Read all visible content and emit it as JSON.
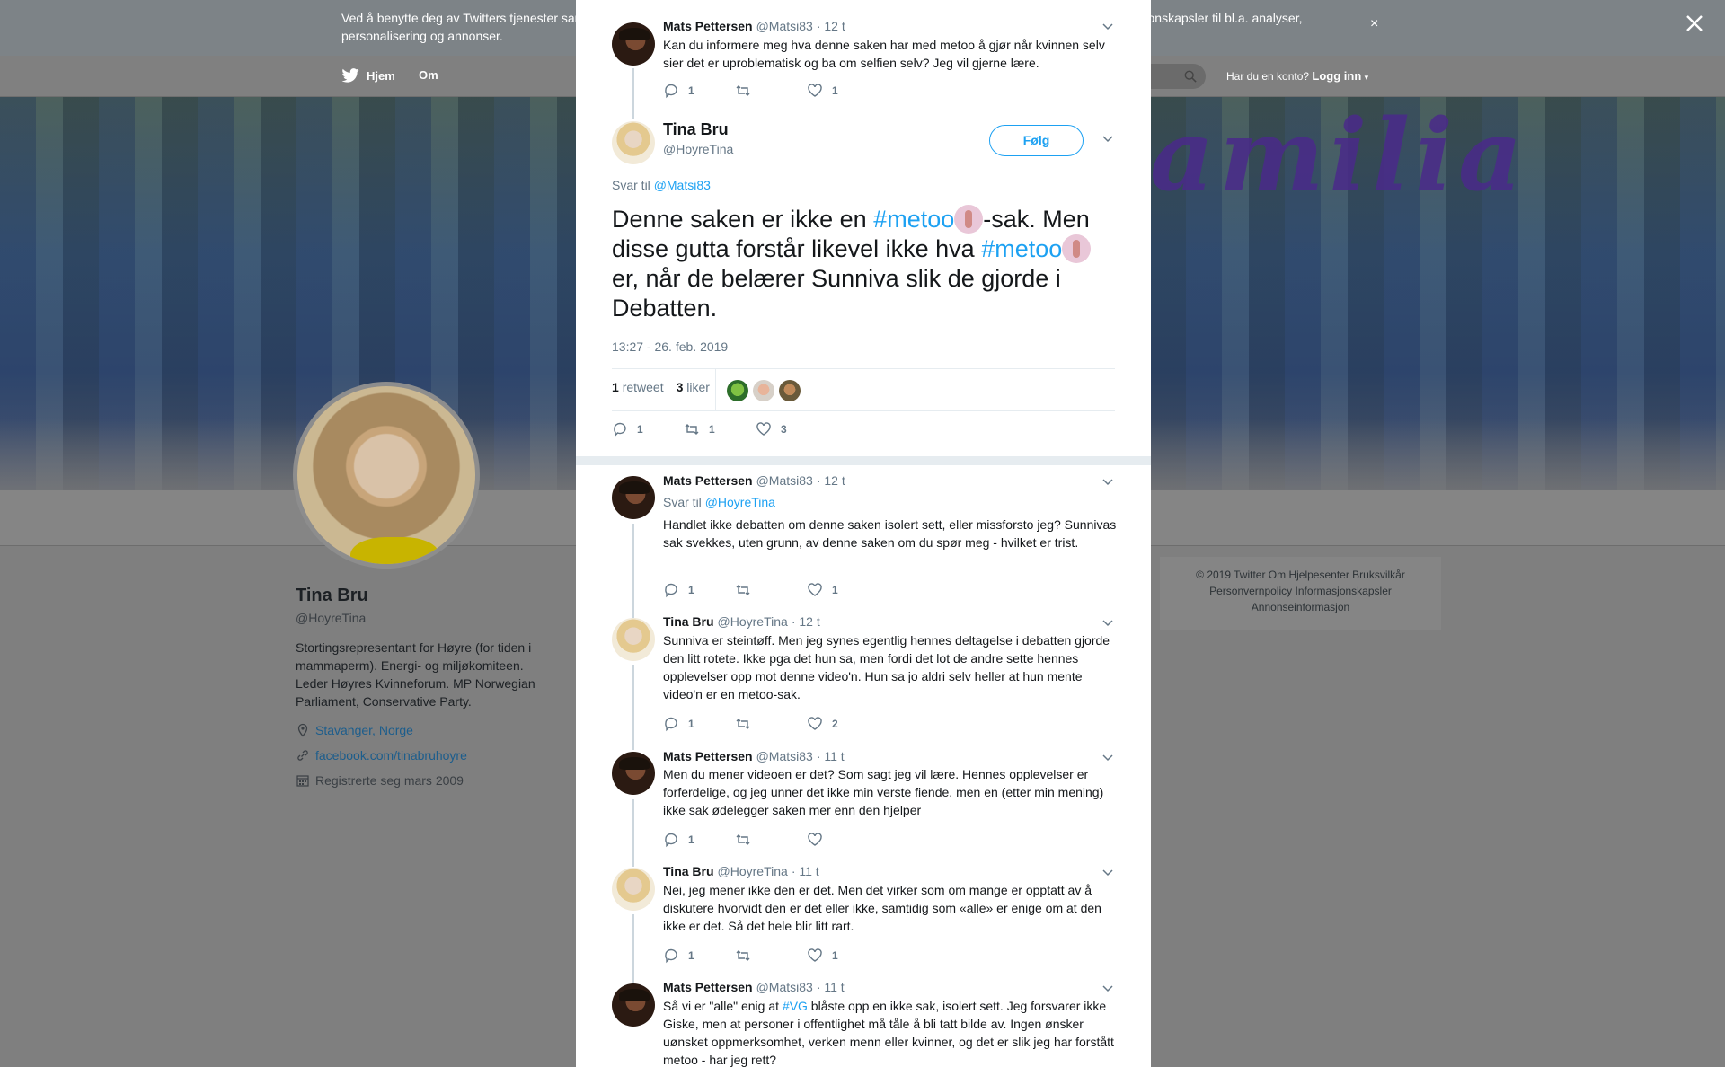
{
  "cookie_banner": {
    "text": "Ved å benytte deg av Twitters tjenester samtykker du i vår bruk av informasjonskapsler. Vi og våre partnere arbeider globalt og benytter informasjonskapsler til bl.a. analyser, personalisering og annonser.",
    "close": "×"
  },
  "nav": {
    "home": "Hjem",
    "about": "Om",
    "account_prompt": "Har du en konto?",
    "login": "Logg inn"
  },
  "banner_word": "amilia",
  "profile": {
    "name": "Tina Bru",
    "handle": "@HoyreTina",
    "bio": "Stortingsrepresentant for Høyre (for tiden i mammaperm). Energi- og miljøkomiteen. Leder Høyres Kvinneforum. MP Norwegian Parliament, Conservative Party.",
    "location": "Stavanger, Norge",
    "website": "facebook.com/tinabruhoyre",
    "joined": "Registrerte seg mars 2009"
  },
  "footer": {
    "line1": "© 2019 Twitter   Om   Hjelpesenter   Bruksvilkår",
    "line2": "Personvernpolicy   Informasjonskapsler",
    "line3": "Annonseinformasjon"
  },
  "modal": {
    "parent": {
      "name": "Mats Pettersen",
      "handle": "@Matsi83",
      "time": "· 12 t",
      "text": "Kan du informere meg hva denne saken har med metoo å gjør når kvinnen selv sier det er uproblematisk og ba om selfien selv? Jeg vil gjerne lære.",
      "replies": "1",
      "retweets": "",
      "likes": "1"
    },
    "main": {
      "name": "Tina Bru",
      "handle": "@HoyreTina",
      "follow": "Følg",
      "reply_label": "Svar til",
      "reply_handle": "@Matsi83",
      "text_1": "Denne saken er ikke en ",
      "hashtag_1": "#metoo",
      "text_2": "-sak. Men disse gutta forstår likevel ikke hva ",
      "hashtag_2": "#metoo",
      "text_3": "er, når de belærer Sunniva slik de gjorde i Debatten.",
      "timestamp": "13:27 - 26. feb. 2019",
      "retweet_count": "1",
      "retweet_label": "retweet",
      "like_count": "3",
      "like_label": "liker",
      "replies": "1",
      "retweets": "1",
      "likes": "3"
    },
    "replies": [
      {
        "name": "Mats Pettersen",
        "handle": "@Matsi83",
        "time": "· 12 t",
        "reply_label": "Svar til",
        "reply_handle": "@HoyreTina",
        "text": "Handlet ikke debatten om denne saken isolert sett, eller missforsto jeg? Sunnivas sak svekkes, uten grunn, av denne saken om du spør meg - hvilket er trist.",
        "replies": "1",
        "retweets": "",
        "likes": "1"
      },
      {
        "name": "Tina Bru",
        "handle": "@HoyreTina",
        "time": "· 12 t",
        "text": "Sunniva er steintøff. Men jeg synes egentlig hennes deltagelse i debatten gjorde den litt rotete. Ikke pga det hun sa, men fordi det lot de andre sette hennes opplevelser opp mot denne video'n. Hun sa jo aldri selv heller at hun mente video'n er en metoo-sak.",
        "replies": "1",
        "retweets": "",
        "likes": "2"
      },
      {
        "name": "Mats Pettersen",
        "handle": "@Matsi83",
        "time": "· 11 t",
        "text": "Men du mener videoen er det? Som sagt jeg vil lære. Hennes opplevelser er forferdelige, og jeg unner det ikke min verste fiende, men en (etter min mening) ikke sak ødelegger saken mer enn den hjelper",
        "replies": "1",
        "retweets": "",
        "likes": ""
      },
      {
        "name": "Tina Bru",
        "handle": "@HoyreTina",
        "time": "· 11 t",
        "text": "Nei, jeg mener ikke den er det. Men det virker som om mange er opptatt av å diskutere hvorvidt den er det eller ikke, samtidig som «alle» er enige om at den ikke er det. Så det hele blir litt rart.",
        "replies": "1",
        "retweets": "",
        "likes": "1"
      },
      {
        "name": "Mats Pettersen",
        "handle": "@Matsi83",
        "time": "· 11 t",
        "text_1": "Så vi er \"alle\" enig at ",
        "hashtag": "#VG",
        "text_2": " blåste opp en ikke sak, isolert sett. Jeg forsvarer ikke Giske, men at personer i offentlighet må tåle å bli tatt bilde av. Ingen ønsker uønsket oppmerksomhet, verken menn eller kvinner, og det er slik jeg har forstått metoo - har jeg rett?"
      }
    ]
  },
  "colors": {
    "link": "#1da1f2",
    "muted": "#657786",
    "text": "#14171a"
  }
}
